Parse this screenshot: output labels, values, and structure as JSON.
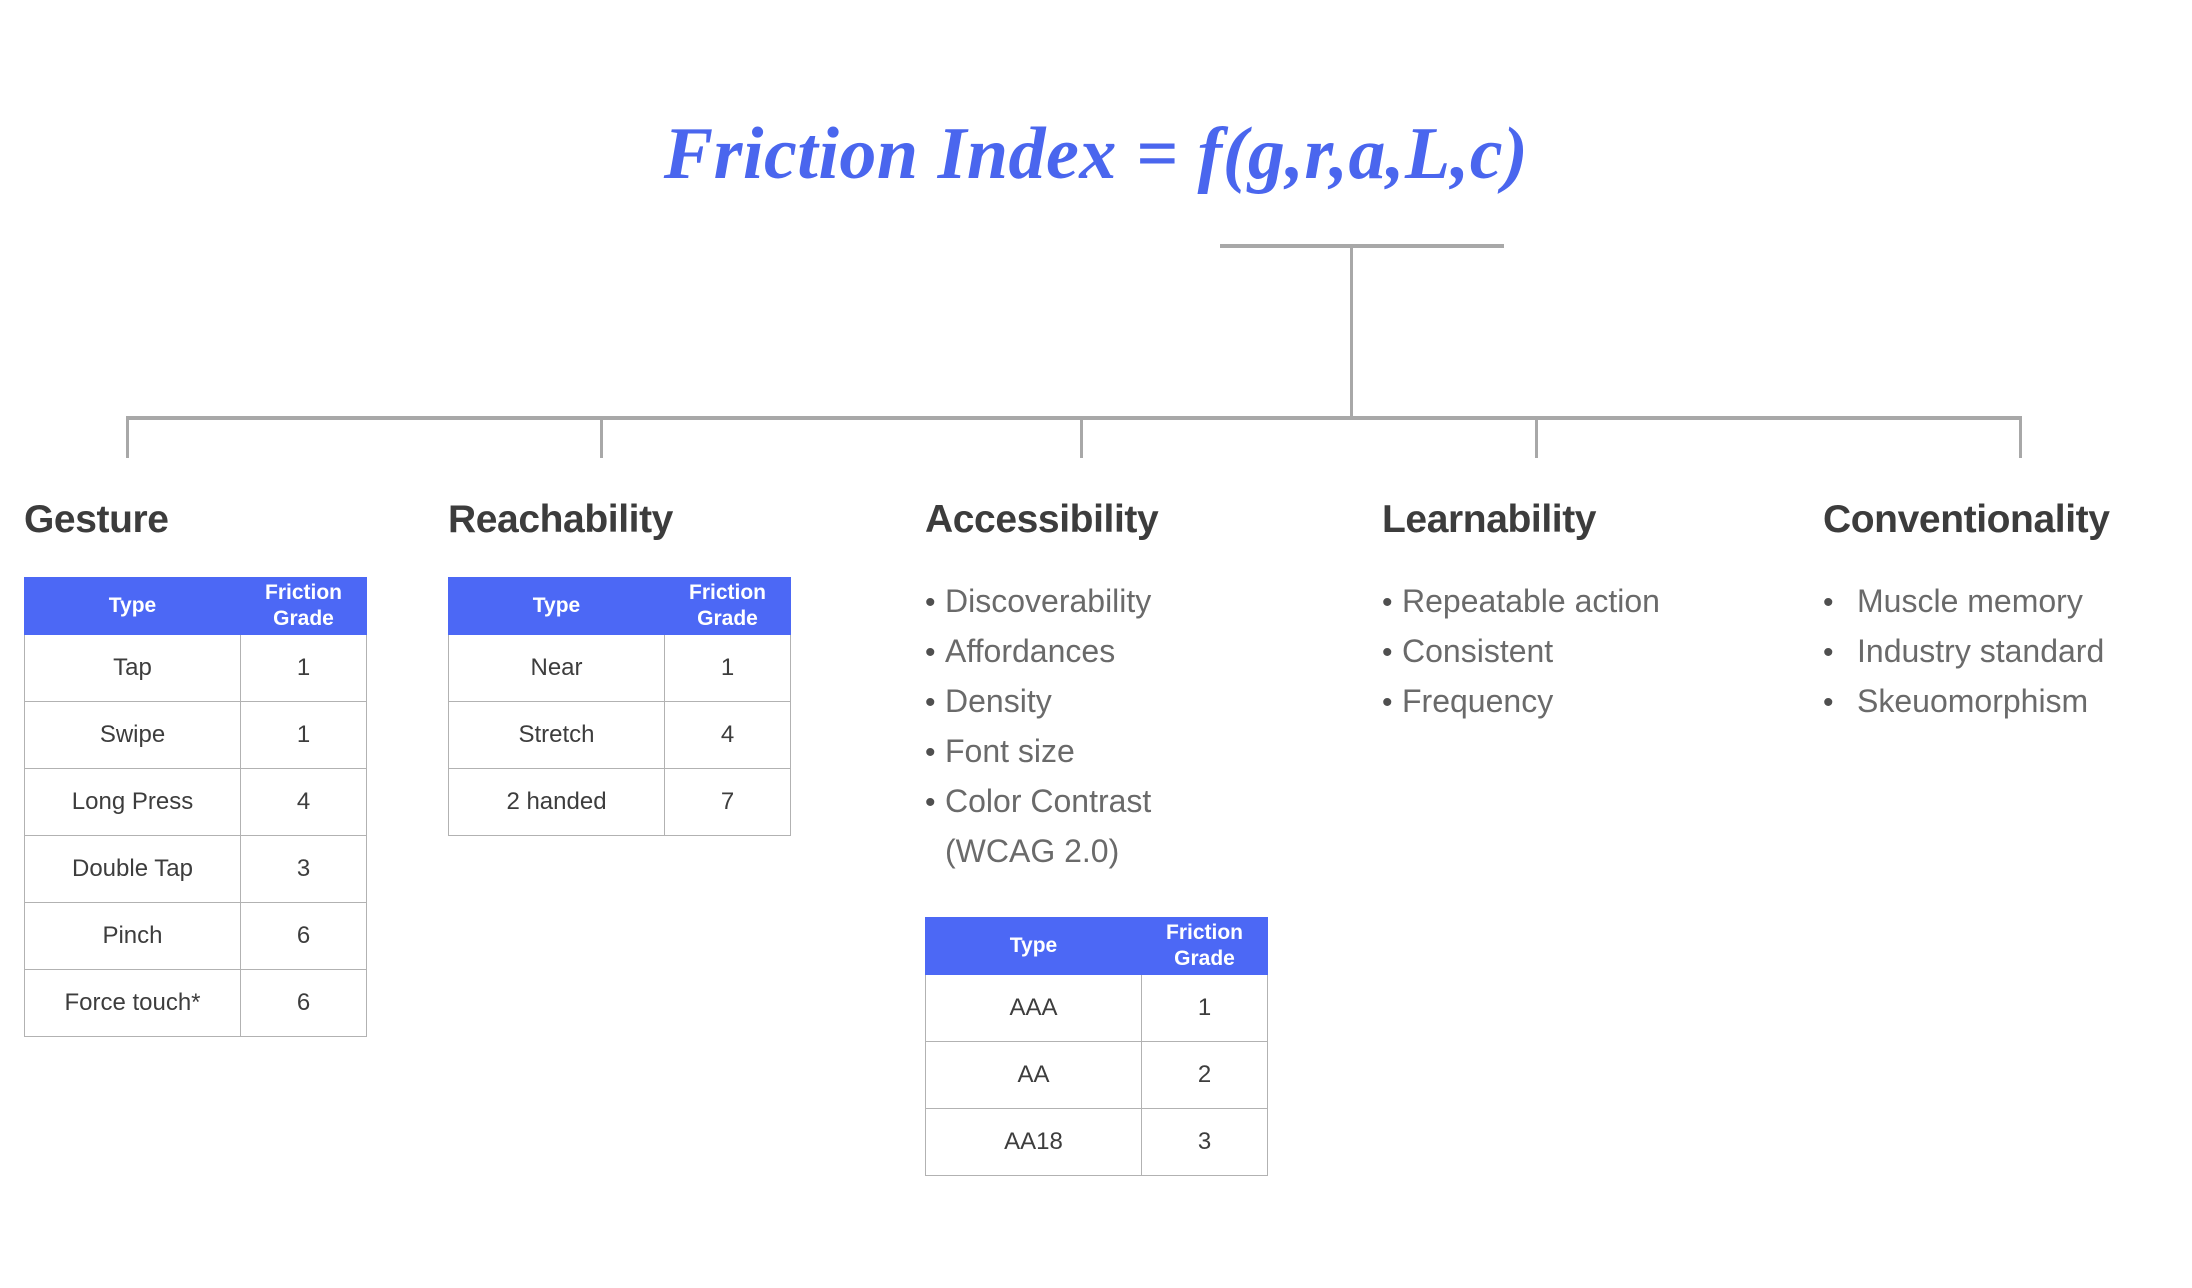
{
  "title": "Friction Index = f(g,r,a,L,c)",
  "colors": {
    "accent_blue": "#4c68f5",
    "title_blue": "#4a66ee",
    "heading_gray": "#3c3c3c",
    "body_gray": "#6a6a6a",
    "line_gray": "#a8a8a8"
  },
  "table_headers": {
    "type": "Type",
    "friction_grade": "Friction Grade"
  },
  "columns": {
    "gesture": {
      "title": "Gesture",
      "table": {
        "headers": [
          "Type",
          "Friction Grade"
        ],
        "rows": [
          {
            "type": "Tap",
            "grade": "1"
          },
          {
            "type": "Swipe",
            "grade": "1"
          },
          {
            "type": "Long Press",
            "grade": "4"
          },
          {
            "type": "Double Tap",
            "grade": "3"
          },
          {
            "type": "Pinch",
            "grade": "6"
          },
          {
            "type": "Force touch*",
            "grade": "6"
          }
        ]
      }
    },
    "reachability": {
      "title": "Reachability",
      "table": {
        "headers": [
          "Type",
          "Friction Grade"
        ],
        "rows": [
          {
            "type": "Near",
            "grade": "1"
          },
          {
            "type": "Stretch",
            "grade": "4"
          },
          {
            "type": "2 handed",
            "grade": "7"
          }
        ]
      }
    },
    "accessibility": {
      "title": "Accessibility",
      "bullets": [
        "Discoverability",
        "Affordances",
        "Density",
        "Font size",
        "Color Contrast"
      ],
      "bullet_continuation": "(WCAG 2.0)",
      "table": {
        "headers": [
          "Type",
          "Friction Grade"
        ],
        "rows": [
          {
            "type": "AAA",
            "grade": "1"
          },
          {
            "type": "AA",
            "grade": "2"
          },
          {
            "type": "AA18",
            "grade": "3"
          }
        ]
      }
    },
    "learnability": {
      "title": "Learnability",
      "bullets": [
        "Repeatable action",
        "Consistent",
        "Frequency"
      ]
    },
    "conventionality": {
      "title": "Conventionality",
      "bullets": [
        "Muscle memory",
        "Industry standard",
        "Skeuomorphism"
      ]
    }
  },
  "bullet_glyph": "•"
}
